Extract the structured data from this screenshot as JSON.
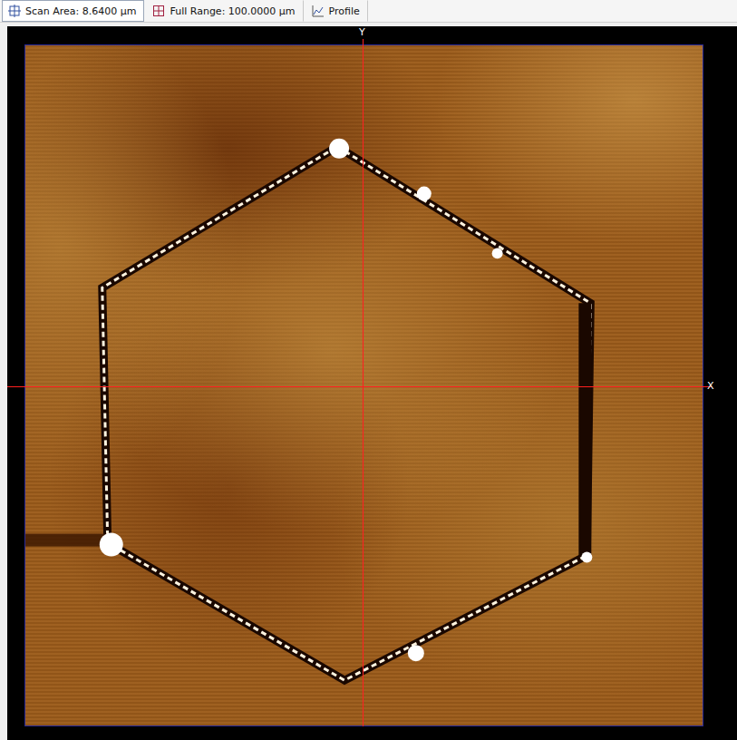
{
  "toolbar": {
    "items": [
      {
        "label": "Scan Area: 8.6400 µm",
        "selected": true,
        "icon": "crosshair"
      },
      {
        "label": "Full Range: 100.0000 µm",
        "selected": false,
        "icon": "grid"
      },
      {
        "label": "Profile",
        "selected": false,
        "icon": "chart"
      }
    ]
  },
  "viewer": {
    "x_axis_label": "X",
    "y_axis_label": "Y"
  }
}
